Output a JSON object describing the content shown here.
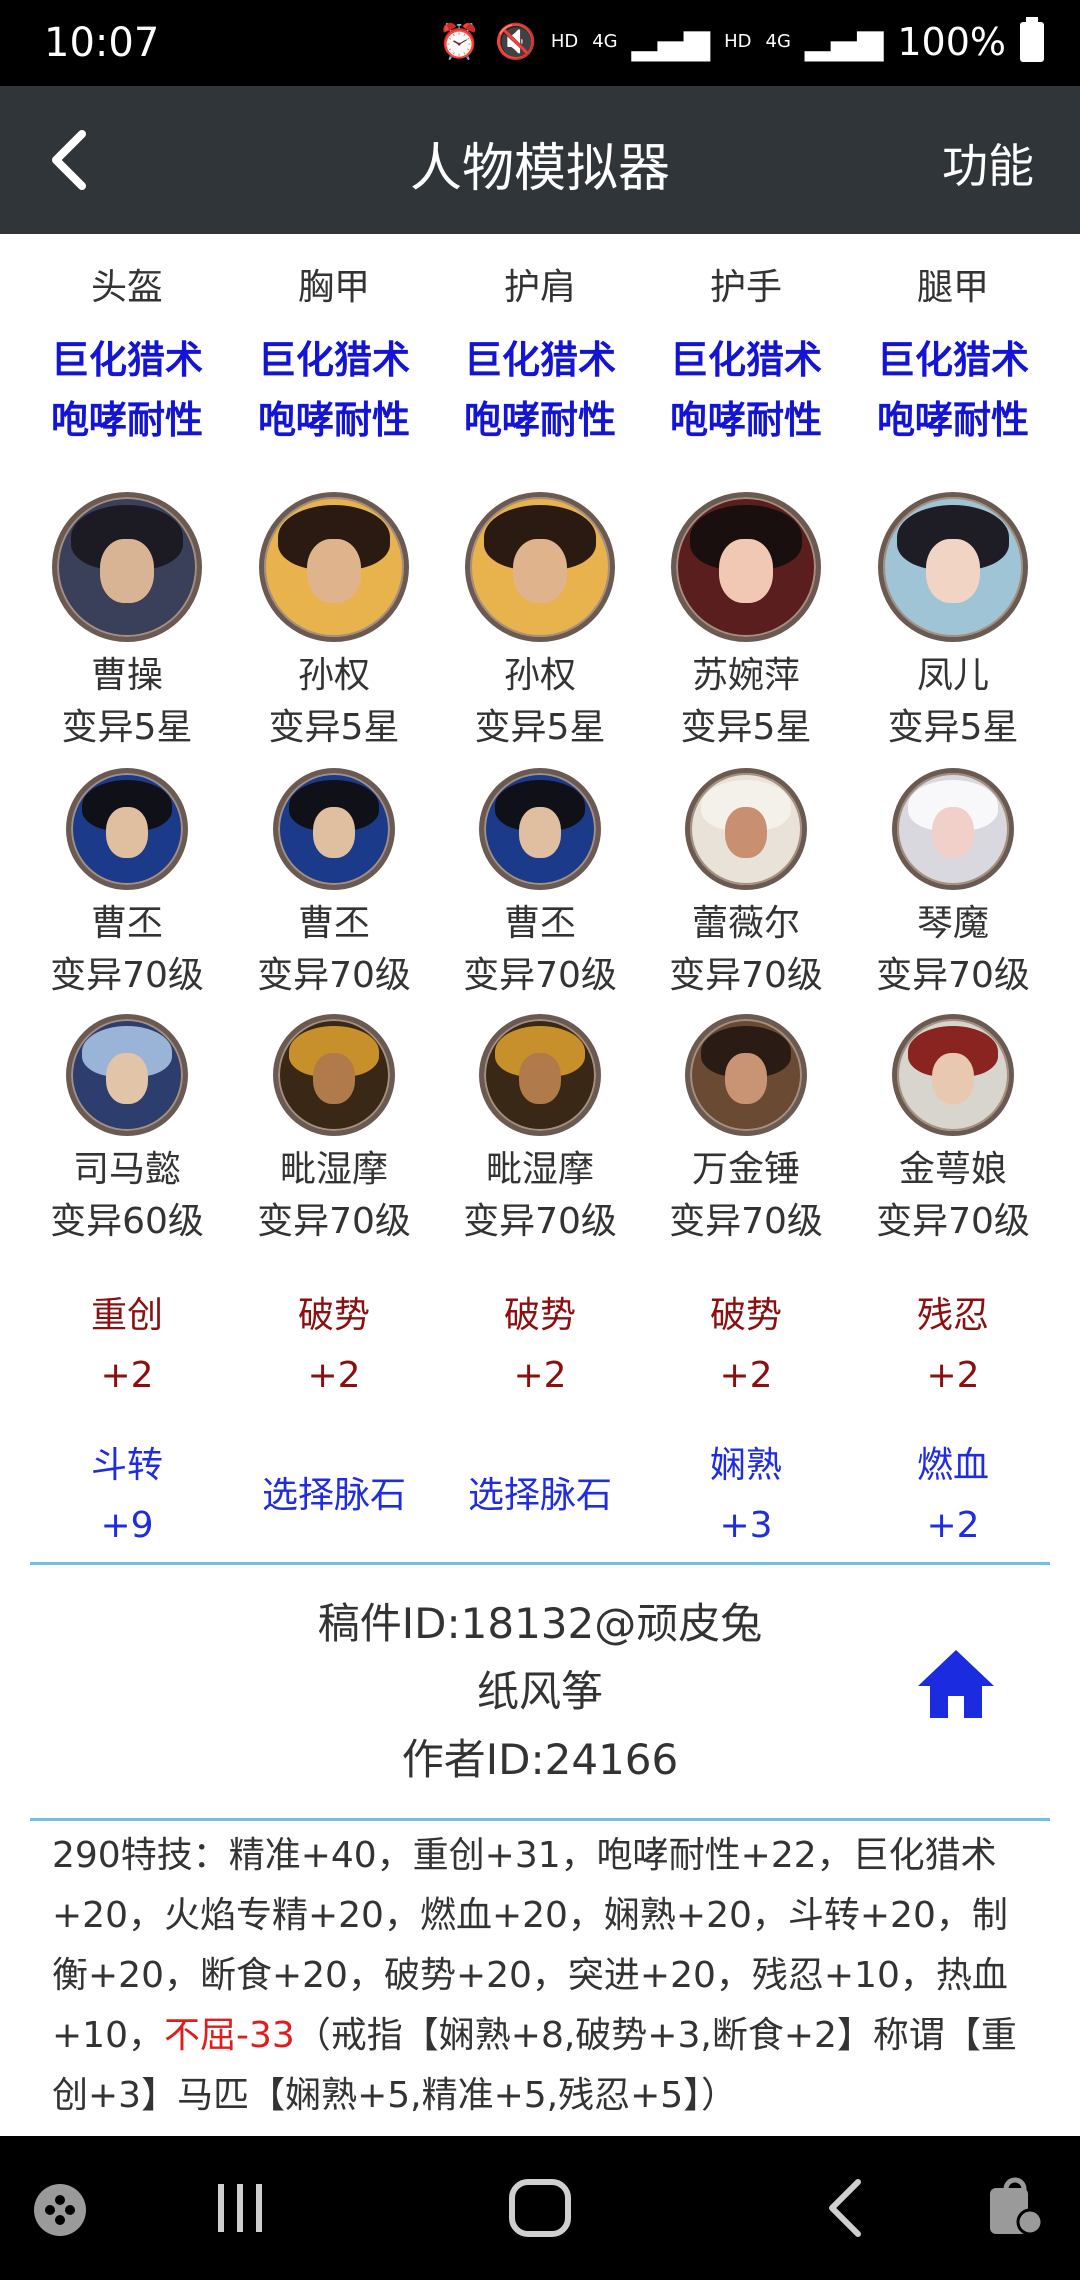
{
  "status": {
    "time": "10:07",
    "battery": "100%",
    "hd1": "HD",
    "net1": "4G",
    "hd2": "HD",
    "net2": "4G"
  },
  "header": {
    "title": "人物模拟器",
    "action": "功能"
  },
  "slots": [
    {
      "name": "头盔",
      "buff1": "巨化猎术",
      "buff2": "咆哮耐性"
    },
    {
      "name": "胸甲",
      "buff1": "巨化猎术",
      "buff2": "咆哮耐性"
    },
    {
      "name": "护肩",
      "buff1": "巨化猎术",
      "buff2": "咆哮耐性"
    },
    {
      "name": "护手",
      "buff1": "巨化猎术",
      "buff2": "咆哮耐性"
    },
    {
      "name": "腿甲",
      "buff1": "巨化猎术",
      "buff2": "咆哮耐性"
    }
  ],
  "row1": [
    {
      "name": "曹操",
      "level": "变异5星"
    },
    {
      "name": "孙权",
      "level": "变异5星"
    },
    {
      "name": "孙权",
      "level": "变异5星"
    },
    {
      "name": "苏婉萍",
      "level": "变异5星"
    },
    {
      "name": "凤儿",
      "level": "变异5星"
    }
  ],
  "row2": [
    {
      "name": "曹丕",
      "level": "变异70级"
    },
    {
      "name": "曹丕",
      "level": "变异70级"
    },
    {
      "name": "曹丕",
      "level": "变异70级"
    },
    {
      "name": "蕾薇尔",
      "level": "变异70级"
    },
    {
      "name": "琴魔",
      "level": "变异70级"
    }
  ],
  "row3": [
    {
      "name": "司马懿",
      "level": "变异60级"
    },
    {
      "name": "毗湿摩",
      "level": "变异70级"
    },
    {
      "name": "毗湿摩",
      "level": "变异70级"
    },
    {
      "name": "万金锤",
      "level": "变异70级"
    },
    {
      "name": "金萼娘",
      "level": "变异70级"
    }
  ],
  "red_stones": [
    {
      "name": "重创",
      "value": "+2"
    },
    {
      "name": "破势",
      "value": "+2"
    },
    {
      "name": "破势",
      "value": "+2"
    },
    {
      "name": "破势",
      "value": "+2"
    },
    {
      "name": "残忍",
      "value": "+2"
    }
  ],
  "blue_stones": [
    {
      "name": "斗转",
      "value": "+9"
    },
    {
      "name": "选择脉石",
      "value": ""
    },
    {
      "name": "选择脉石",
      "value": ""
    },
    {
      "name": "娴熟",
      "value": "+3"
    },
    {
      "name": "燃血",
      "value": "+2"
    }
  ],
  "doc": {
    "id_line": "稿件ID:18132@顽皮兔",
    "name": "纸风筝",
    "author_line": "作者ID:24166"
  },
  "skills": {
    "part1": "290特技：精准+40，重创+31，咆哮耐性+22，巨化猎术+20，火焰专精+20，燃血+20，娴熟+20，斗转+20，制衡+20，断食+20，破势+20，突进+20，残忍+10，热血+10，",
    "warn": "不屈-33",
    "part2": "（戒指【娴熟+8,破势+3,断食+2】称谓【重创+3】马匹【娴熟+5,精准+5,残忍+5】）"
  },
  "colors": {
    "appbar": "#2f3538",
    "buff": "#1414d6",
    "red_stone": "#8b0f0f",
    "blue_stone": "#1f2ce0",
    "divider": "#6ec2e2",
    "warn": "#e21c1c",
    "home": "#1a2be0"
  }
}
